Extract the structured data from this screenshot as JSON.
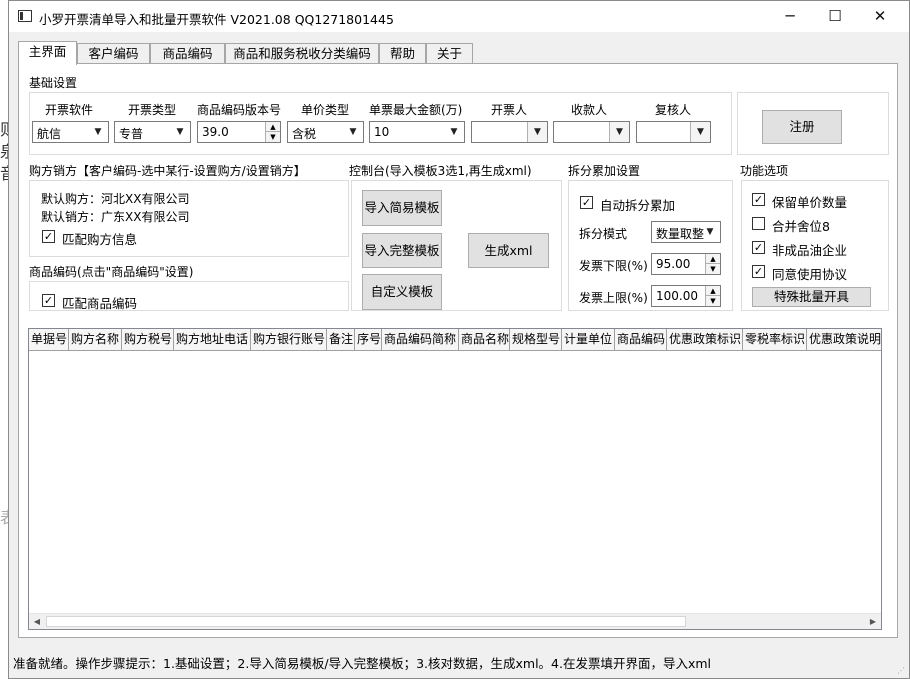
{
  "background_glyphs": [
    "则",
    "泉",
    "音",
    "表"
  ],
  "window": {
    "title": "小罗开票清单导入和批量开票软件 V2021.08 QQ1271801445",
    "controls": {
      "minimize": "─",
      "maximize": "☐",
      "close": "✕"
    }
  },
  "tabs": [
    "主界面",
    "客户编码",
    "商品编码",
    "商品和服务税收分类编码",
    "帮助",
    "关于"
  ],
  "basic_settings": {
    "title": "基础设置",
    "fields": [
      {
        "label": "开票软件",
        "value": "航信"
      },
      {
        "label": "开票类型",
        "value": "专普"
      },
      {
        "label": "商品编码版本号",
        "value": "39.0"
      },
      {
        "label": "单价类型",
        "value": "含税"
      },
      {
        "label": "单票最大金额(万)",
        "value": "10"
      },
      {
        "label": "开票人",
        "value": ""
      },
      {
        "label": "收款人",
        "value": ""
      },
      {
        "label": "复核人",
        "value": ""
      }
    ],
    "register_button": "注册"
  },
  "buyer_seller": {
    "title": "购方销方【客户编码-选中某行-设置购方/设置销方】",
    "default_buyer": "默认购方：河北XX有限公司",
    "default_seller": "默认销方：广东XX有限公司",
    "match_buyer_label": "匹配购方信息",
    "match_buyer_checked": true
  },
  "product_code": {
    "title": "商品编码(点击\"商品编码\"设置)",
    "match_product_label": "匹配商品编码",
    "match_product_checked": true
  },
  "console": {
    "title": "控制台(导入模板3选1,再生成xml)",
    "import_simple": "导入简易模板",
    "import_full": "导入完整模板",
    "custom_template": "自定义模板",
    "generate_xml": "生成xml"
  },
  "split": {
    "title": "拆分累加设置",
    "auto_split_label": "自动拆分累加",
    "auto_split_checked": true,
    "mode_label": "拆分模式",
    "mode_value": "数量取整",
    "lower_label": "发票下限(%)",
    "lower_value": "95.00",
    "upper_label": "发票上限(%)",
    "upper_value": "100.00"
  },
  "features": {
    "title": "功能选项",
    "options": [
      {
        "label": "保留单价数量",
        "checked": true
      },
      {
        "label": "合并舍位8",
        "checked": false
      },
      {
        "label": "非成品油企业",
        "checked": true
      },
      {
        "label": "同意使用协议",
        "checked": true
      }
    ],
    "special_batch_button": "特殊批量开具"
  },
  "grid": {
    "columns": [
      "单据号",
      "购方名称",
      "购方税号",
      "购方地址电话",
      "购方银行账号",
      "备注",
      "序号",
      "商品编码简称",
      "商品名称",
      "规格型号",
      "计量单位",
      "商品编码",
      "优惠政策标识",
      "零税率标识",
      "优惠政策说明"
    ],
    "rows": []
  },
  "status": "准备就绪。操作步骤提示：1.基础设置；2.导入简易模板/导入完整模板；3.核对数据，生成xml。4.在发票填开界面，导入xml",
  "icons": {
    "dropdown": "▼",
    "spin_up": "▲",
    "spin_down": "▼",
    "scroll_left": "◀",
    "scroll_right": "▶",
    "check": "✓"
  }
}
